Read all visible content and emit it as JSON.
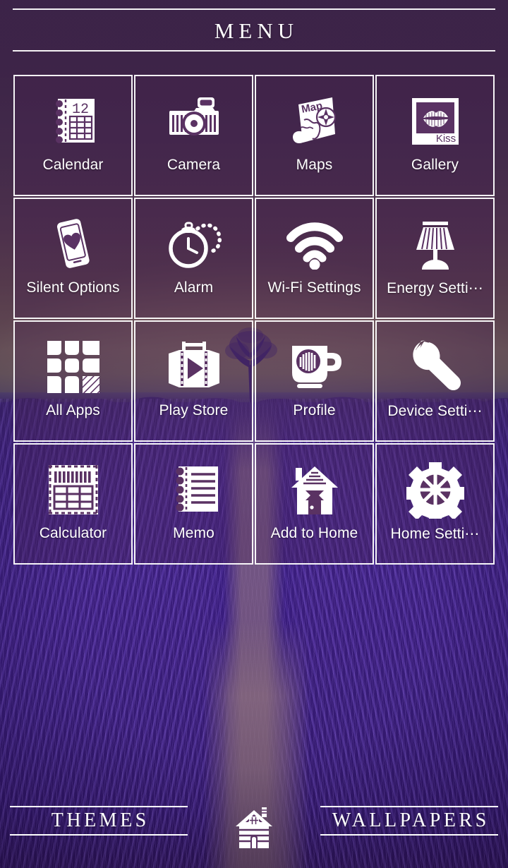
{
  "header": {
    "title": "MENU"
  },
  "grid": {
    "items": [
      {
        "label": "Calendar",
        "icon": "calendar-icon"
      },
      {
        "label": "Camera",
        "icon": "camera-icon"
      },
      {
        "label": "Maps",
        "icon": "map-icon"
      },
      {
        "label": "Gallery",
        "icon": "photo-frame-kiss-icon"
      },
      {
        "label": "Silent Options",
        "icon": "phone-heart-icon"
      },
      {
        "label": "Alarm",
        "icon": "pocket-watch-icon"
      },
      {
        "label": "Wi-Fi Settings",
        "icon": "wifi-icon"
      },
      {
        "label": "Energy Setti⋯",
        "icon": "table-lamp-icon"
      },
      {
        "label": "All Apps",
        "icon": "app-grid-icon"
      },
      {
        "label": "Play Store",
        "icon": "film-play-icon"
      },
      {
        "label": "Profile",
        "icon": "coffee-mug-icon"
      },
      {
        "label": "Device Setti⋯",
        "icon": "wrench-icon"
      },
      {
        "label": "Calculator",
        "icon": "calculator-icon"
      },
      {
        "label": "Memo",
        "icon": "notepad-icon"
      },
      {
        "label": "Add to Home",
        "icon": "house-icon"
      },
      {
        "label": "Home Setti⋯",
        "icon": "gear-icon"
      }
    ]
  },
  "icon_text": {
    "calendar_day": "12",
    "map_word": "Map",
    "gallery_word": "Kiss"
  },
  "bottombar": {
    "themes_label": "THEMES",
    "wallpapers_label": "WALLPAPERS",
    "home_icon": "cabin-home-icon"
  },
  "colors": {
    "foreground": "#ffffff",
    "tile_fill": "rgba(70,35,80,0.32)",
    "field_purple": "#3d2185",
    "sky_purple": "#5d4061",
    "sunset_warm": "#9c8274"
  }
}
